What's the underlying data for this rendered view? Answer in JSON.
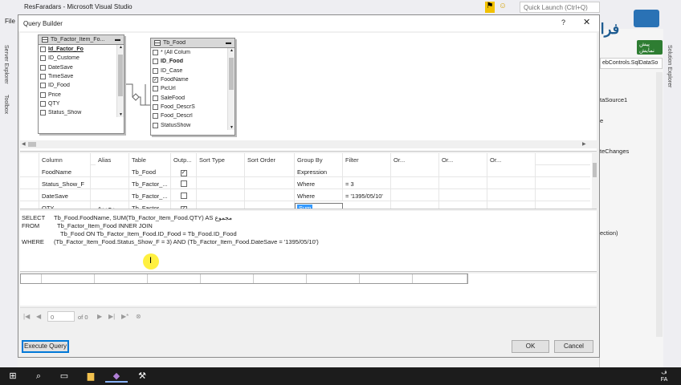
{
  "vs": {
    "title": "ResFaradars - Microsoft Visual Studio",
    "quick_launch_placeholder": "Quick Launch (Ctrl+Q)",
    "menu_first": "File",
    "left_tabs": [
      "Server Explorer",
      "Toolbox"
    ],
    "right_tab": "Solution Explorer",
    "right_panel": {
      "combo": "ebControls.SqlDataSo",
      "items": [
        "taSource1",
        "e",
        "teChanges",
        "ection)"
      ]
    }
  },
  "logo": {
    "brand": "فرادرس",
    "tag": "پیش نمایش"
  },
  "dialog": {
    "title": "Query Builder",
    "help": "?",
    "close": "✕",
    "tables": [
      {
        "name": "Tb_Factor_Item_Fo...",
        "fields": [
          {
            "label": "Id_Factor_Fo",
            "checked": false,
            "style": "sel",
            "marker": ""
          },
          {
            "label": "ID_Custome",
            "checked": false,
            "style": "",
            "marker": ""
          },
          {
            "label": "DateSave",
            "checked": false,
            "style": "",
            "marker": "filter"
          },
          {
            "label": "TimeSave",
            "checked": false,
            "style": "",
            "marker": ""
          },
          {
            "label": "ID_Food",
            "checked": false,
            "style": "",
            "marker": ""
          },
          {
            "label": "Price",
            "checked": false,
            "style": "",
            "marker": ""
          },
          {
            "label": "QTY",
            "checked": false,
            "style": "",
            "marker": "sum"
          },
          {
            "label": "Status_Show",
            "checked": false,
            "style": "",
            "marker": "filter"
          }
        ]
      },
      {
        "name": "Tb_Food",
        "fields": [
          {
            "label": "* (All Colum",
            "checked": false,
            "style": "",
            "marker": ""
          },
          {
            "label": "ID_Food",
            "checked": false,
            "style": "bold",
            "marker": ""
          },
          {
            "label": "ID_Case",
            "checked": false,
            "style": "",
            "marker": ""
          },
          {
            "label": "FoodName",
            "checked": true,
            "style": "",
            "marker": ""
          },
          {
            "label": "PicUrl",
            "checked": false,
            "style": "",
            "marker": ""
          },
          {
            "label": "SaleFood",
            "checked": false,
            "style": "",
            "marker": ""
          },
          {
            "label": "Food_DescrS",
            "checked": false,
            "style": "",
            "marker": ""
          },
          {
            "label": "Food_Descrl",
            "checked": false,
            "style": "",
            "marker": ""
          },
          {
            "label": "StatusShow",
            "checked": false,
            "style": "",
            "marker": ""
          }
        ]
      }
    ],
    "grid": {
      "headers": [
        "Column",
        "Alias",
        "Table",
        "Outp...",
        "Sort Type",
        "Sort Order",
        "Group By",
        "Filter",
        "Or...",
        "Or...",
        "Or..."
      ],
      "rows": [
        [
          "FoodName",
          "",
          "Tb_Food",
          true,
          "",
          "",
          "Expression",
          "",
          "",
          "",
          ""
        ],
        [
          "Status_Show_F",
          "",
          "Tb_Factor_...",
          false,
          "",
          "",
          "Where",
          "= 3",
          "",
          "",
          ""
        ],
        [
          "DateSave",
          "",
          "Tb_Factor_...",
          false,
          "",
          "",
          "Where",
          "= '1395/05/10'",
          "",
          "",
          ""
        ],
        [
          "QTY",
          "مجموع",
          "Tb_Factor_...",
          true,
          "",
          "",
          "Sum",
          "",
          "",
          "",
          ""
        ]
      ]
    },
    "sql": [
      {
        "kw": "SELECT",
        "text": "Tb_Food.FoodName, SUM(Tb_Factor_Item_Food.QTY) AS مجموع"
      },
      {
        "kw": "FROM",
        "text": "Tb_Factor_Item_Food INNER JOIN"
      },
      {
        "kw": "",
        "text": "Tb_Food ON Tb_Factor_Item_Food.ID_Food = Tb_Food.ID_Food"
      },
      {
        "kw": "WHERE",
        "text": "(Tb_Factor_Item_Food.Status_Show_F = 3) AND (Tb_Factor_Item_Food.DateSave = '1395/05/10')"
      }
    ],
    "nav": {
      "first": "|◀",
      "prev": "◀",
      "position": "0",
      "of": "of 0",
      "next": "▶",
      "last": "▶|",
      "new": "▶*",
      "delete": "⊗"
    },
    "buttons": {
      "execute": "Execute Query",
      "ok": "OK",
      "cancel": "Cancel"
    }
  },
  "taskbar": {
    "clock_lang": "FA",
    "clock_top": "ف"
  }
}
